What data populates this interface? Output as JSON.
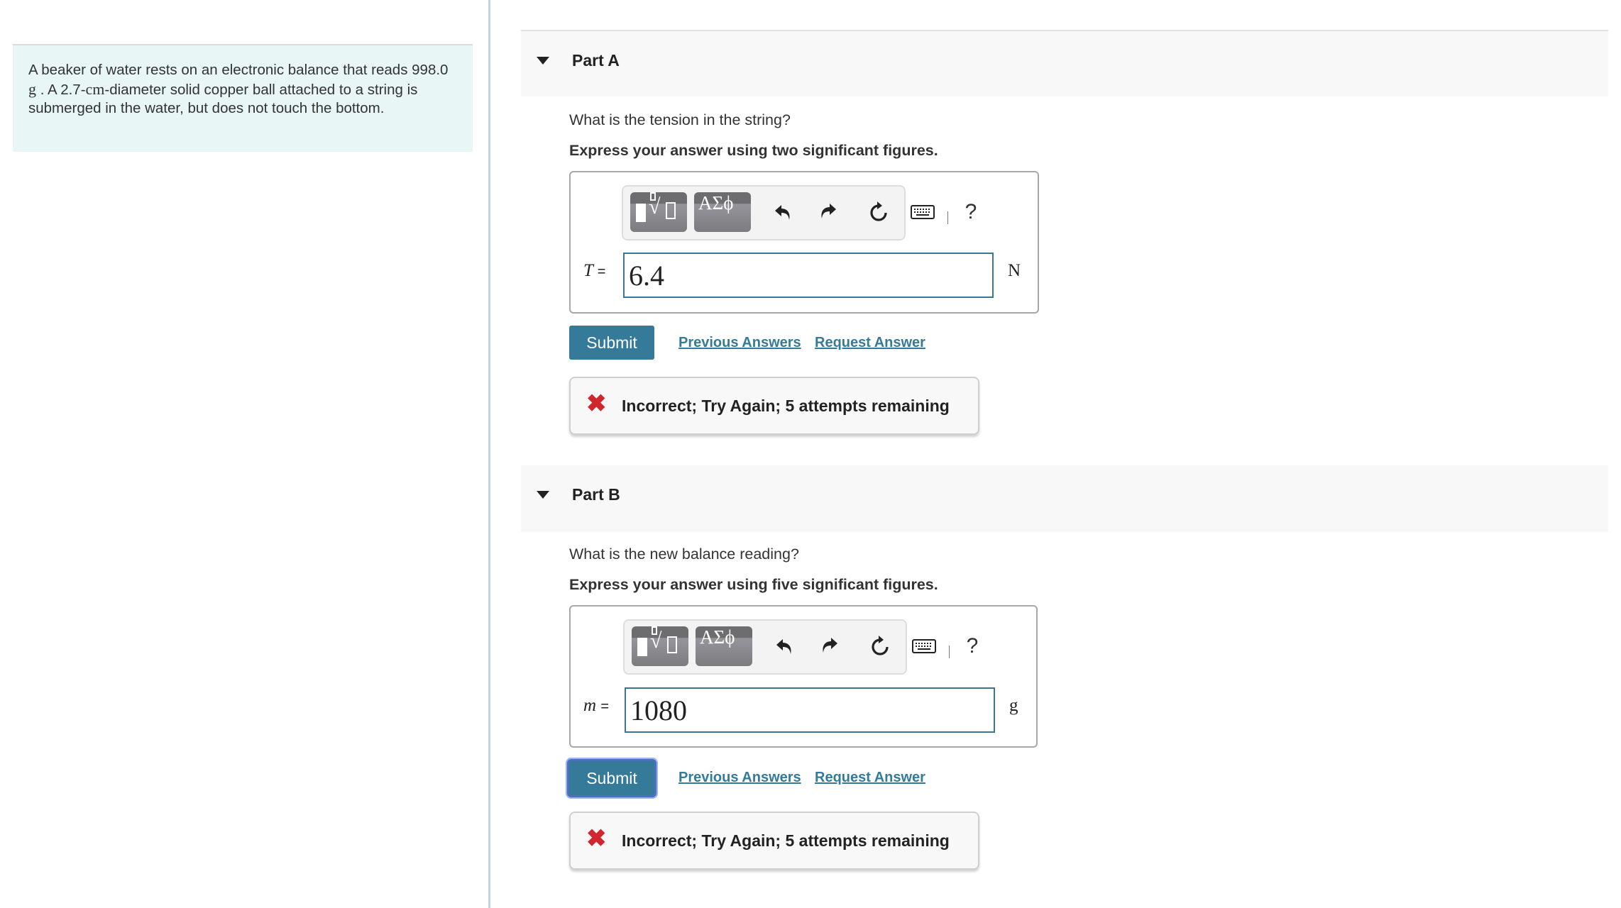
{
  "problem": {
    "text_before_mass": "A beaker of water rests on an electronic balance that reads 998.0 ",
    "mass_unit": "g",
    "text_mid": " . A 2.7-",
    "length_unit": "cm",
    "text_after": "-diameter solid copper ball attached to a string is submerged in the water, but does not touch the bottom."
  },
  "toolbar": {
    "templates_icon": "templates-radical-icon",
    "symbols_label": "ΑΣϕ",
    "undo_icon": "undo-icon",
    "redo_icon": "redo-icon",
    "reset_icon": "reset-icon",
    "keyboard_icon": "keyboard-icon",
    "help_label": "?"
  },
  "parts": [
    {
      "title": "Part A",
      "question": "What is the tension in the string?",
      "instruction": "Express your answer using two significant figures.",
      "variable": "T",
      "equals": "=",
      "answer_value": "6.4",
      "unit": "N",
      "submit_label": "Submit",
      "previous_answers_label": "Previous Answers",
      "request_answer_label": "Request Answer",
      "feedback": "Incorrect; Try Again; 5 attempts remaining"
    },
    {
      "title": "Part B",
      "question": "What is the new balance reading?",
      "instruction": "Express your answer using five significant figures.",
      "variable": "m",
      "equals": "=",
      "answer_value": "1080",
      "unit": "g",
      "submit_label": "Submit",
      "previous_answers_label": "Previous Answers",
      "request_answer_label": "Request Answer",
      "feedback": "Incorrect; Try Again; 5 attempts remaining"
    }
  ],
  "colors": {
    "accent": "#367a9a",
    "error": "#d0262c",
    "intro_bg": "#e8f6f6",
    "part_header_bg": "#f8f8f8"
  }
}
